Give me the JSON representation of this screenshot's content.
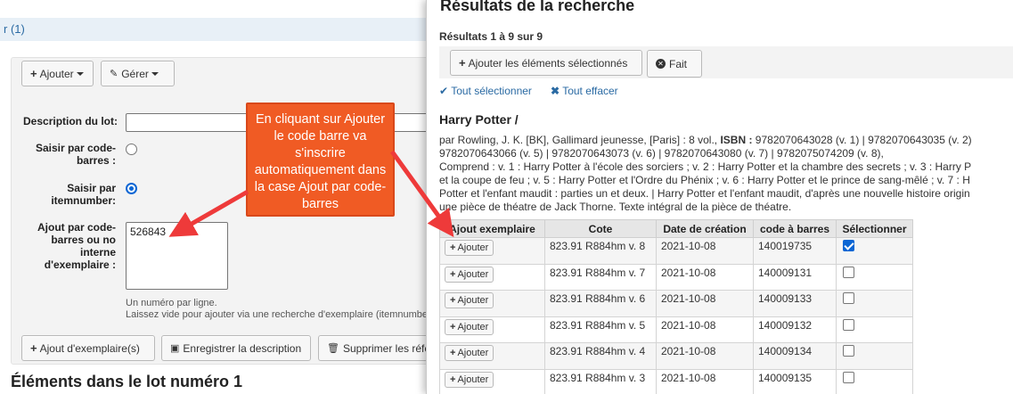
{
  "background_page": {
    "breadcrumb_fragment": "r (1)",
    "toolbar": {
      "add_label": "Ajouter",
      "manage_label": "Gérer"
    },
    "form": {
      "description_label": "Description du lot:",
      "barcode_label": "Saisir par code-barres :",
      "itemnumber_label": "Saisir par itemnumber:",
      "add_by_label": "Ajout par code-barres ou no interne d'exemplaire :",
      "textarea_value": "526843",
      "hint_line1": "Un numéro par ligne.",
      "hint_line2": "Laissez vide pour ajouter via une recherche d'exemplaire (itemnumbe"
    },
    "actions": {
      "add_items_label": "Ajout d'exemplaire(s)",
      "save_description_label": "Enregistrer la description",
      "delete_label": "Supprimer les réfé"
    },
    "section_title": "Éléments dans le lot numéro 1"
  },
  "modal": {
    "title": "Résultats de la recherche",
    "results_count": "Résultats 1 à 9 sur 9",
    "add_selected_label": "Ajouter les éléments sélectionnés",
    "done_label": "Fait",
    "select_all_label": "Tout sélectionner",
    "clear_all_label": "Tout effacer",
    "book_title": "Harry Potter /",
    "description_lines": [
      "par Rowling, J. K. [BK], Gallimard jeunesse, [Paris] : 8 vol., ISBN : 9782070643028 (v. 1) | 9782070643035 (v. 2)",
      "9782070643066 (v. 5) | 9782070643073 (v. 6) | 9782070643080 (v. 7) | 9782075074209 (v. 8),",
      "Comprend : v. 1 : Harry Potter à l'école des sorciers ; v. 2 : Harry Potter et la chambre des secrets ; v. 3 : Harry P",
      "et la coupe de feu ; v. 5 : Harry Potter et l'Ordre du Phénix ; v. 6 : Harry Potter et le prince de sang-mêlé ; v. 7 : H",
      "Potter et l'enfant maudit : parties un et deux. | Harry Potter et l'enfant maudit, d'après une nouvelle histoire origin",
      "une pièce de théatre de Jack Thorne. Texte intégral de la pièce de théatre."
    ],
    "table": {
      "headers": [
        "Ajout exemplaire",
        "Cote",
        "Date de création",
        "code à barres",
        "Sélectionner"
      ],
      "add_button_label": "Ajouter",
      "rows": [
        {
          "cote": "823.91 R884hm v. 8",
          "date": "2021-10-08",
          "barcode": "140019735",
          "selected": true
        },
        {
          "cote": "823.91 R884hm v. 7",
          "date": "2021-10-08",
          "barcode": "140009131",
          "selected": false
        },
        {
          "cote": "823.91 R884hm v. 6",
          "date": "2021-10-08",
          "barcode": "140009133",
          "selected": false
        },
        {
          "cote": "823.91 R884hm v. 5",
          "date": "2021-10-08",
          "barcode": "140009132",
          "selected": false
        },
        {
          "cote": "823.91 R884hm v. 4",
          "date": "2021-10-08",
          "barcode": "140009134",
          "selected": false
        },
        {
          "cote": "823.91 R884hm v. 3",
          "date": "2021-10-08",
          "barcode": "140009135",
          "selected": false
        }
      ]
    }
  },
  "callout": {
    "text": "En cliquant sur Ajouter le code barre va s'inscrire automatiquement dans la case Ajout par code-barres",
    "color": "#f05b24"
  }
}
